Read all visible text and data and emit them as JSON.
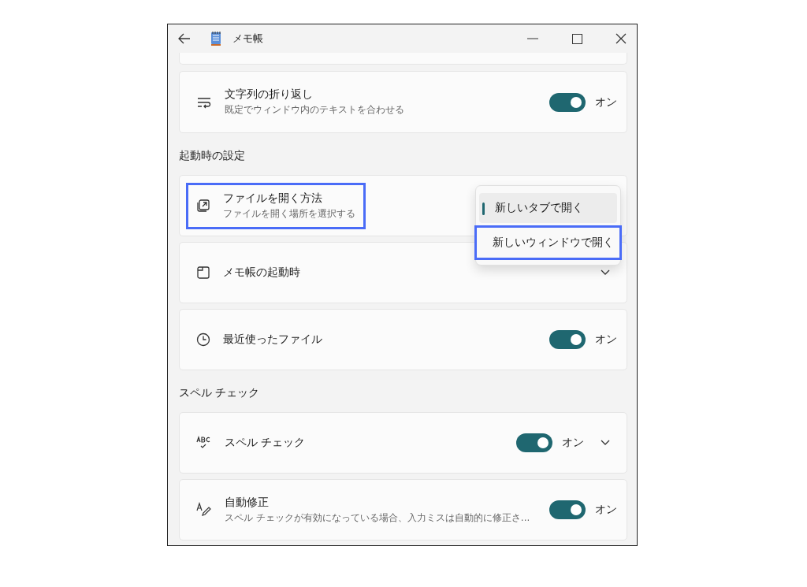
{
  "window": {
    "title": "メモ帳"
  },
  "sections": [
    {
      "rows": [
        {
          "title": "文字列の折り返し",
          "subtitle": "既定でウィンドウ内のテキストを合わせる",
          "highlighted": false,
          "toggle": {
            "on": true,
            "label": "オン"
          }
        }
      ]
    },
    {
      "heading": "起動時の設定",
      "rows": [
        {
          "title": "ファイルを開く方法",
          "subtitle": "ファイルを開く場所を選択する",
          "highlighted": true,
          "menu": {
            "options": [
              {
                "label": "新しいタブで開く",
                "selected": true,
                "highlighted": false
              },
              {
                "label": "新しいウィンドウで開く",
                "selected": false,
                "highlighted": true
              }
            ]
          }
        },
        {
          "title": "メモ帳の起動時",
          "highlighted": false,
          "expandable": true,
          "expanded": false
        },
        {
          "title": "最近使ったファイル",
          "highlighted": false,
          "toggle": {
            "on": true,
            "label": "オン"
          }
        }
      ]
    },
    {
      "heading": "スペル チェック",
      "rows": [
        {
          "title": "スペル チェック",
          "highlighted": false,
          "toggle": {
            "on": true,
            "label": "オン"
          },
          "expandable": true,
          "expanded": false
        },
        {
          "title": "自動修正",
          "subtitle": "スペル チェックが有効になっている場合、入力ミスは自動的に修正さ...",
          "highlighted": false,
          "toggle": {
            "on": true,
            "label": "オン"
          }
        }
      ]
    }
  ]
}
